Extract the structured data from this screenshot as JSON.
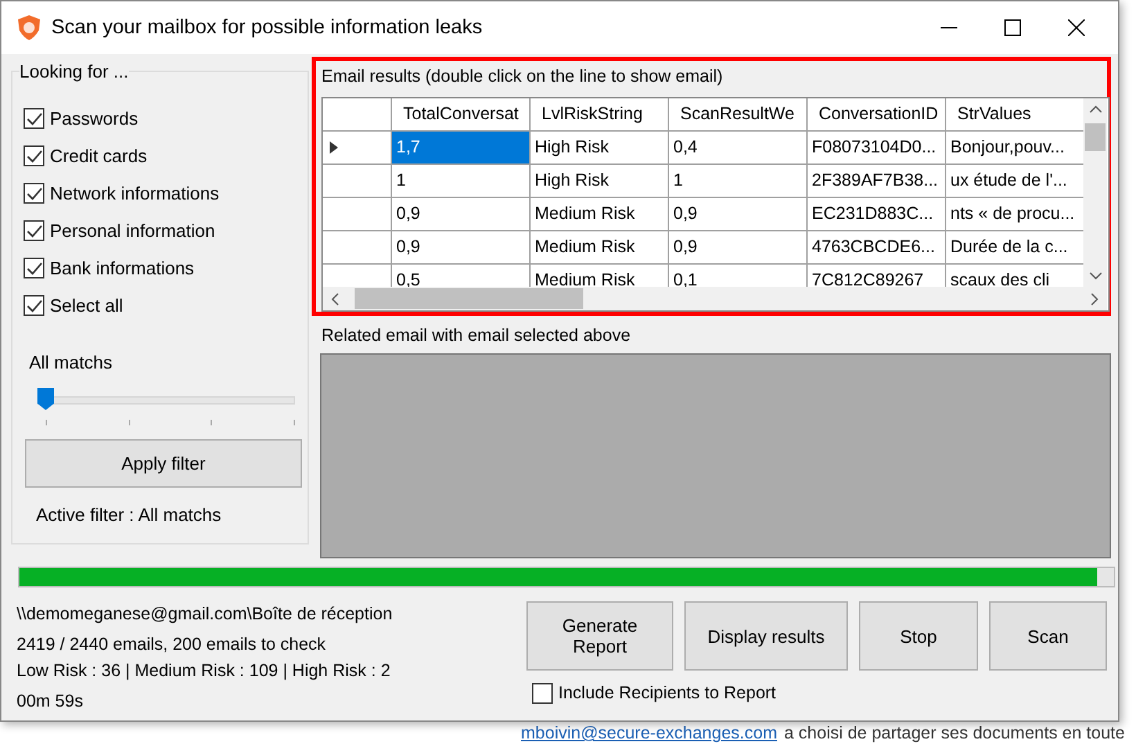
{
  "window": {
    "title": "Scan your mailbox for possible information leaks"
  },
  "looking_for": {
    "title": "Looking for ...",
    "options": [
      {
        "label": "Passwords",
        "checked": true
      },
      {
        "label": "Credit cards",
        "checked": true
      },
      {
        "label": "Network informations",
        "checked": true
      },
      {
        "label": "Personal information",
        "checked": true
      },
      {
        "label": "Bank informations",
        "checked": true
      },
      {
        "label": "Select all",
        "checked": true
      }
    ]
  },
  "filter": {
    "label": "All matchs",
    "level": 0,
    "button": "Apply filter",
    "active": "Active filter : All matchs"
  },
  "results": {
    "title": "Email results (double click on the line to show email)",
    "columns": [
      "TotalConversat",
      "LvlRiskString",
      "ScanResultWe",
      "ConversationID",
      "StrValues"
    ],
    "rows": [
      {
        "selected": true,
        "cells": [
          "1,7",
          "High Risk",
          "0,4",
          "F08073104D0...",
          "Bonjour,pouv..."
        ]
      },
      {
        "selected": false,
        "cells": [
          "1",
          "High Risk",
          "1",
          "2F389AF7B38...",
          "ux étude de l'..."
        ]
      },
      {
        "selected": false,
        "cells": [
          "0,9",
          "Medium Risk",
          "0,9",
          "EC231D883C...",
          "nts « de procu..."
        ]
      },
      {
        "selected": false,
        "cells": [
          "0,9",
          "Medium Risk",
          "0,9",
          "4763CBCDE6...",
          "Durée de la c..."
        ]
      },
      {
        "selected": false,
        "cells": [
          "0,5",
          "Medium Risk",
          "0,1",
          "7C812C89267",
          "scaux des cli"
        ]
      }
    ]
  },
  "related": {
    "title": "Related email with email selected above"
  },
  "progress": {
    "level": 0.985
  },
  "status": {
    "mailbox": "\\\\demomeganese@gmail.com\\Boîte de réception",
    "count": "2419 / 2440 emails, 200 emails to check",
    "risks": "Low Risk : 36 | Medium Risk : 109 | High Risk : 2",
    "elapsed": "00m 59s"
  },
  "buttons": [
    "Generate Report",
    "Display results",
    "Stop",
    "Scan"
  ],
  "include_recipients": {
    "label": "Include Recipients to Report",
    "checked": false
  },
  "background": {
    "link": "mboivin@secure-exchanges.com",
    "text": "a choisi de partager ses documents en toute"
  }
}
